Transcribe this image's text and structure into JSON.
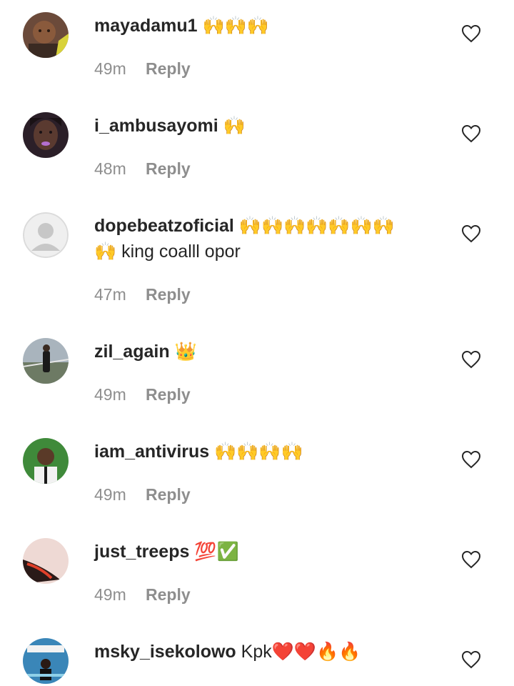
{
  "comments": [
    {
      "username": "mayadamu1",
      "text": "🙌🙌🙌",
      "line2": "",
      "time": "49m",
      "reply_label": "Reply",
      "avatar": "photo-woman-avatar",
      "like_icon": "heart-outline-icon"
    },
    {
      "username": "i_ambusayomi",
      "text": "🙌",
      "line2": "",
      "time": "48m",
      "reply_label": "Reply",
      "avatar": "photo-woman-purple-lips-avatar",
      "like_icon": "heart-outline-icon"
    },
    {
      "username": "dopebeatzoficial",
      "text": "🙌🙌🙌🙌🙌🙌🙌",
      "line2": "🙌 king coalll opor",
      "time": "47m",
      "reply_label": "Reply",
      "avatar": "default-grey-avatar",
      "like_icon": "heart-outline-icon"
    },
    {
      "username": "zil_again",
      "text": "👑",
      "line2": "",
      "time": "49m",
      "reply_label": "Reply",
      "avatar": "photo-man-outdoor-avatar",
      "like_icon": "heart-outline-icon"
    },
    {
      "username": "iam_antivirus",
      "text": "🙌🙌🙌🙌",
      "line2": "",
      "time": "49m",
      "reply_label": "Reply",
      "avatar": "photo-man-green-avatar",
      "like_icon": "heart-outline-icon"
    },
    {
      "username": "just_treeps",
      "text": "💯✅",
      "line2": "",
      "time": "49m",
      "reply_label": "Reply",
      "avatar": "photo-abstract-red-avatar",
      "like_icon": "heart-outline-icon"
    },
    {
      "username": "msky_isekolowo",
      "text": "Kpk❤️❤️🔥🔥",
      "line2": "",
      "time": "",
      "reply_label": "",
      "avatar": "photo-poster-avatar",
      "like_icon": "heart-outline-icon"
    }
  ],
  "colors": {
    "text": "#262626",
    "secondary": "#8e8e8e",
    "background": "#ffffff"
  }
}
